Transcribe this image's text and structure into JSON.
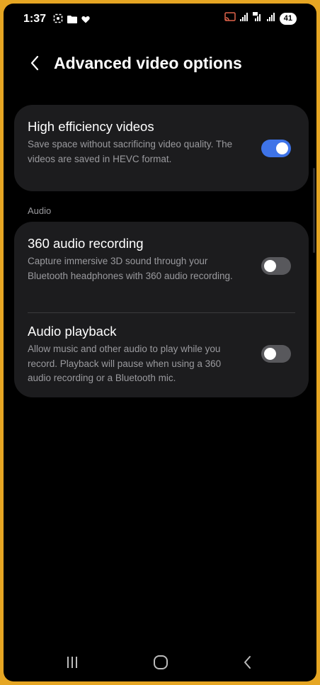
{
  "status_bar": {
    "time": "1:37",
    "battery": "41"
  },
  "header": {
    "title": "Advanced video options"
  },
  "settings": {
    "hevc": {
      "title": "High efficiency videos",
      "description": "Save space without sacrificing video quality. The videos are saved in HEVC format.",
      "enabled": true
    },
    "audio_section_label": "Audio",
    "audio_360": {
      "title": "360 audio recording",
      "description": "Capture immersive 3D sound through your Bluetooth headphones with 360 audio recording.",
      "enabled": false
    },
    "audio_playback": {
      "title": "Audio playback",
      "description": "Allow music and other audio to play while you record. Playback will pause when using a 360 audio recording or a Bluetooth mic.",
      "enabled": false
    }
  },
  "colors": {
    "toggle_on": "#3e73e8",
    "toggle_off": "#58585c",
    "card_background": "#1c1c1e",
    "frame_border": "#e6a623"
  },
  "icons": {
    "status_left": [
      "screen-record-icon",
      "folder-icon",
      "heart-icon"
    ],
    "status_right": [
      "cast-icon",
      "signal-icon",
      "volte-4g-icon",
      "signal-icon"
    ],
    "navigation": [
      "recents-icon",
      "home-icon",
      "back-icon"
    ]
  }
}
